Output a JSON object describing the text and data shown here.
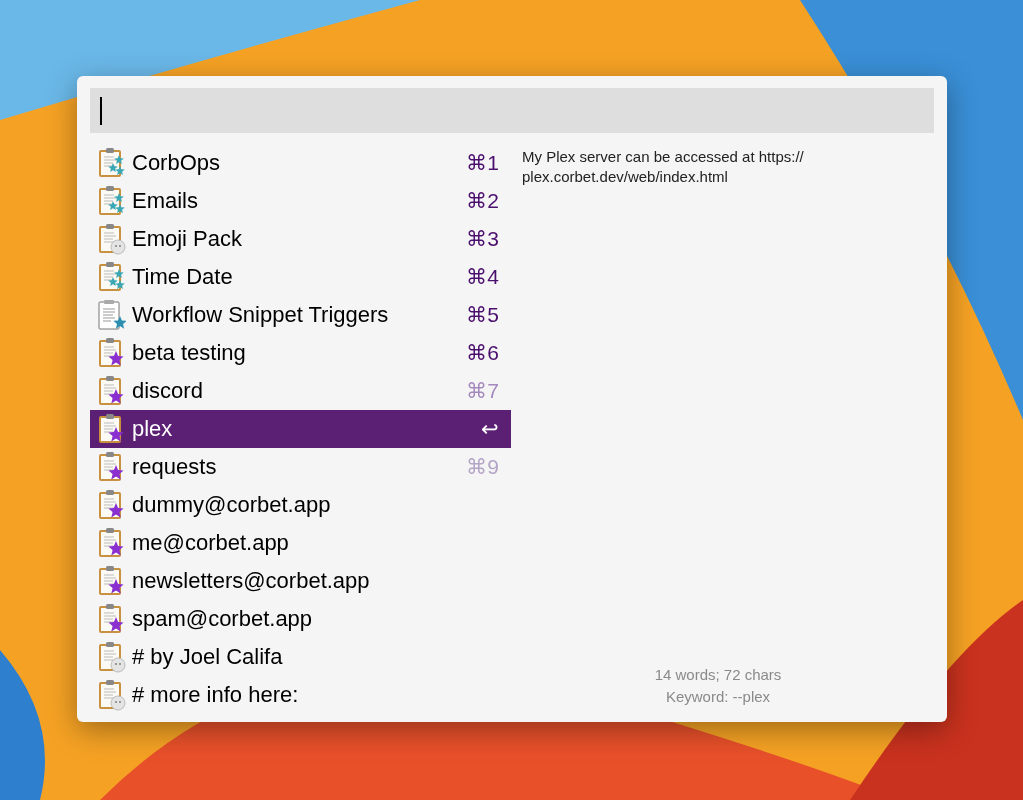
{
  "snippets": [
    {
      "name": "CorbOps",
      "shortcut": "⌘1",
      "color": "#4b0f6e",
      "kind": "multi-star",
      "selected": false
    },
    {
      "name": "Emails",
      "shortcut": "⌘2",
      "color": "#4b0f6e",
      "kind": "multi-star",
      "selected": false
    },
    {
      "name": "Emoji Pack",
      "shortcut": "⌘3",
      "color": "#4b0f6e",
      "kind": "emoji",
      "selected": false
    },
    {
      "name": "Time Date",
      "shortcut": "⌘4",
      "color": "#4b0f6e",
      "kind": "multi-star",
      "selected": false
    },
    {
      "name": "Workflow Snippet Triggers",
      "shortcut": "⌘5",
      "color": "#4b0f6e",
      "kind": "template-star",
      "selected": false
    },
    {
      "name": "beta testing",
      "shortcut": "⌘6",
      "color": "#4b0f6e",
      "kind": "star",
      "selected": false
    },
    {
      "name": "discord",
      "shortcut": "⌘7",
      "color": "#a58bbd",
      "kind": "star",
      "selected": false
    },
    {
      "name": "plex",
      "shortcut": "↩",
      "color": "#ffffff",
      "kind": "star",
      "selected": true
    },
    {
      "name": "requests",
      "shortcut": "⌘9",
      "color": "#b4a4c6",
      "kind": "star",
      "selected": false
    },
    {
      "name": "dummy@corbet.app",
      "kind": "star",
      "selected": false
    },
    {
      "name": "me@corbet.app",
      "kind": "star",
      "selected": false
    },
    {
      "name": "newsletters@corbet.app",
      "kind": "star",
      "selected": false
    },
    {
      "name": "spam@corbet.app",
      "kind": "star",
      "selected": false
    },
    {
      "name": "# by Joel Califa",
      "kind": "emoji",
      "selected": false
    },
    {
      "name": "# more info here:",
      "kind": "emoji",
      "selected": false
    }
  ],
  "preview": {
    "text": "My Plex server can be accessed at https:// plex.corbet.dev/web/index.html",
    "stats": "14 words; 72 chars",
    "keyword": "Keyword: --plex"
  }
}
